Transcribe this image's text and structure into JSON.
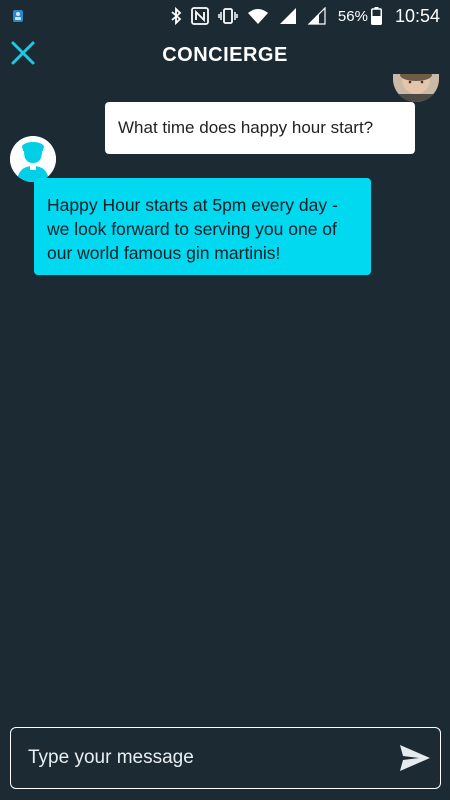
{
  "status_bar": {
    "battery_percent": "56%",
    "time": "10:54",
    "icons": [
      "notification-icon",
      "bluetooth-icon",
      "nfc-icon",
      "vibrate-icon",
      "wifi-icon",
      "signal-icon",
      "signal-2-icon",
      "battery-icon"
    ]
  },
  "header": {
    "title": "CONCIERGE",
    "close_icon": "close-icon",
    "accent_color": "#1fc8e3"
  },
  "messages": [
    {
      "sender": "user",
      "text": "What time does happy hour start?"
    },
    {
      "sender": "concierge",
      "text": "Happy Hour starts at 5pm every day - we look forward to serving you one of our world famous gin martinis!"
    }
  ],
  "composer": {
    "placeholder": "Type your message",
    "value": "",
    "send_icon": "send-icon"
  },
  "colors": {
    "background": "#1c2a33",
    "bot_bubble": "#00d9f0",
    "user_bubble": "#ffffff"
  }
}
